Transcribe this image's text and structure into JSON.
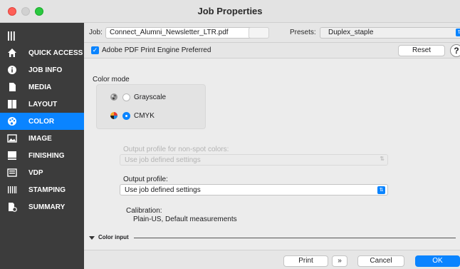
{
  "window": {
    "title": "Job Properties"
  },
  "sidebar": {
    "menu_glyph": "|||",
    "items": [
      {
        "label": "QUICK ACCESS",
        "icon": "home-icon",
        "active": false
      },
      {
        "label": "JOB INFO",
        "icon": "info-icon",
        "active": false
      },
      {
        "label": "MEDIA",
        "icon": "page-icon",
        "active": false
      },
      {
        "label": "LAYOUT",
        "icon": "layout-icon",
        "active": false
      },
      {
        "label": "COLOR",
        "icon": "palette-icon",
        "active": true
      },
      {
        "label": "IMAGE",
        "icon": "image-icon",
        "active": false
      },
      {
        "label": "FINISHING",
        "icon": "finishing-icon",
        "active": false
      },
      {
        "label": "VDP",
        "icon": "vdp-icon",
        "active": false
      },
      {
        "label": "STAMPING",
        "icon": "stamping-icon",
        "active": false
      },
      {
        "label": "SUMMARY",
        "icon": "summary-icon",
        "active": false
      }
    ]
  },
  "toolbar": {
    "job_label": "Job:",
    "job_value": "Connect_Alumni_Newsletter_LTR.pdf",
    "presets_label": "Presets:",
    "presets_value": "Duplex_staple"
  },
  "options": {
    "pdf_engine_label": "Adobe PDF Print Engine Preferred",
    "pdf_engine_checked": true,
    "reset_label": "Reset",
    "help_label": "?"
  },
  "color_mode": {
    "title": "Color mode",
    "options": [
      {
        "label": "Grayscale",
        "selected": false
      },
      {
        "label": "CMYK",
        "selected": true
      }
    ]
  },
  "output_profile_non_spot": {
    "label": "Output profile for non-spot colors:",
    "value": "Use job defined settings",
    "disabled": true
  },
  "output_profile": {
    "label": "Output profile:",
    "value": "Use job defined settings"
  },
  "calibration": {
    "label": "Calibration:",
    "value": "Plain-US, Default measurements"
  },
  "color_input": {
    "label": "Color input"
  },
  "footer": {
    "print_label": "Print",
    "more_label": "»",
    "cancel_label": "Cancel",
    "ok_label": "OK"
  },
  "colors": {
    "accent": "#0a84ff",
    "sidebar_bg": "#3c3c3c"
  }
}
